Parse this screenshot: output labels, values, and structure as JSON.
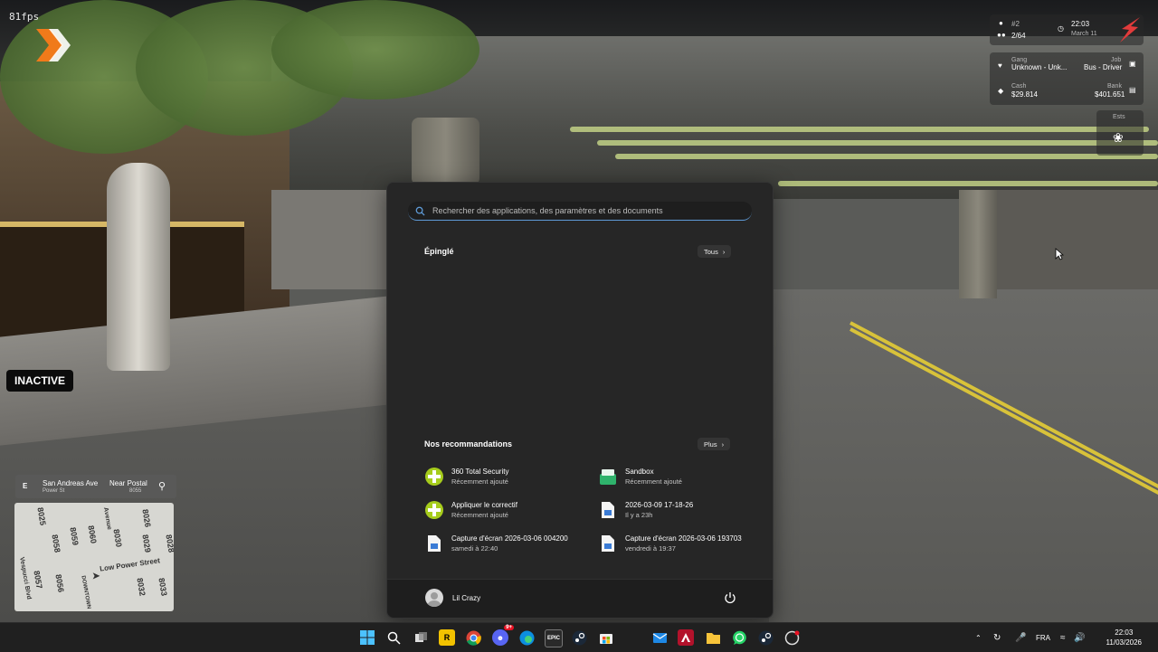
{
  "hud": {
    "fps": "81fps",
    "inactive_label": "INACTIVE",
    "player_id": "#2",
    "players": "2/64",
    "time": "22:03",
    "date": "March 11",
    "gang_label": "Gang",
    "gang_value": "Unknown - Unk...",
    "job_label": "Job",
    "job_value": "Bus - Driver",
    "cash_label": "Cash",
    "cash_value": "$29.814",
    "bank_label": "Bank",
    "bank_value": "$401.651",
    "ests_label": "Ests",
    "location": {
      "compass": "E",
      "street": "San Andreas Ave",
      "area": "Power St",
      "postal_label": "Near Postal",
      "postal_value": "8055"
    },
    "minimap_labels": [
      "8025",
      "8058",
      "8059",
      "8060",
      "8026",
      "8028",
      "8029",
      "8030",
      "8057",
      "8056",
      "8032",
      "8033",
      "Low Power Street",
      "DOWNTOWN",
      "Vespucci Blvd",
      "Avenue"
    ]
  },
  "start_menu": {
    "search_placeholder": "Rechercher des applications, des paramètres et des documents",
    "pinned_title": "Épinglé",
    "pinned_all_label": "Tous",
    "recs_title": "Nos recommandations",
    "recs_more_label": "Plus",
    "recommendations": [
      {
        "name": "360 Total Security",
        "sub": "Récemment ajouté",
        "icon": "plus-icon"
      },
      {
        "name": "Sandbox",
        "sub": "Récemment ajouté",
        "icon": "sandbox-icon"
      },
      {
        "name": "Appliquer le correctif",
        "sub": "Récemment ajouté",
        "icon": "plus-icon"
      },
      {
        "name": "2026-03-09 17-18-26",
        "sub": "Il y a 23h",
        "icon": "file-icon"
      },
      {
        "name": "Capture d'écran 2026-03-06 004200",
        "sub": "samedi à 22:40",
        "icon": "file-icon"
      },
      {
        "name": "Capture d'écran 2026-03-06 193703",
        "sub": "vendredi à 19:37",
        "icon": "file-icon"
      }
    ],
    "user_name": "Lil Crazy"
  },
  "taskbar": {
    "apps": [
      "windows-start",
      "search",
      "task-view",
      "rockstar",
      "chrome",
      "discord",
      "edge",
      "epic-games",
      "steam",
      "store",
      "mail",
      "adobe",
      "file-explorer",
      "whatsapp",
      "steam-2",
      "other"
    ],
    "discord_badge": "9+",
    "epic_label": "EPIC",
    "rockstar_label": "R",
    "language": "FRA",
    "clock_time": "22:03",
    "clock_date": "11/03/2026"
  },
  "colors": {
    "start_bg": "#262626",
    "taskbar_bg": "#202020",
    "accent": "#5f9bd8",
    "logo_orange": "#f07a1a",
    "brand_red": "#e23b3b"
  }
}
